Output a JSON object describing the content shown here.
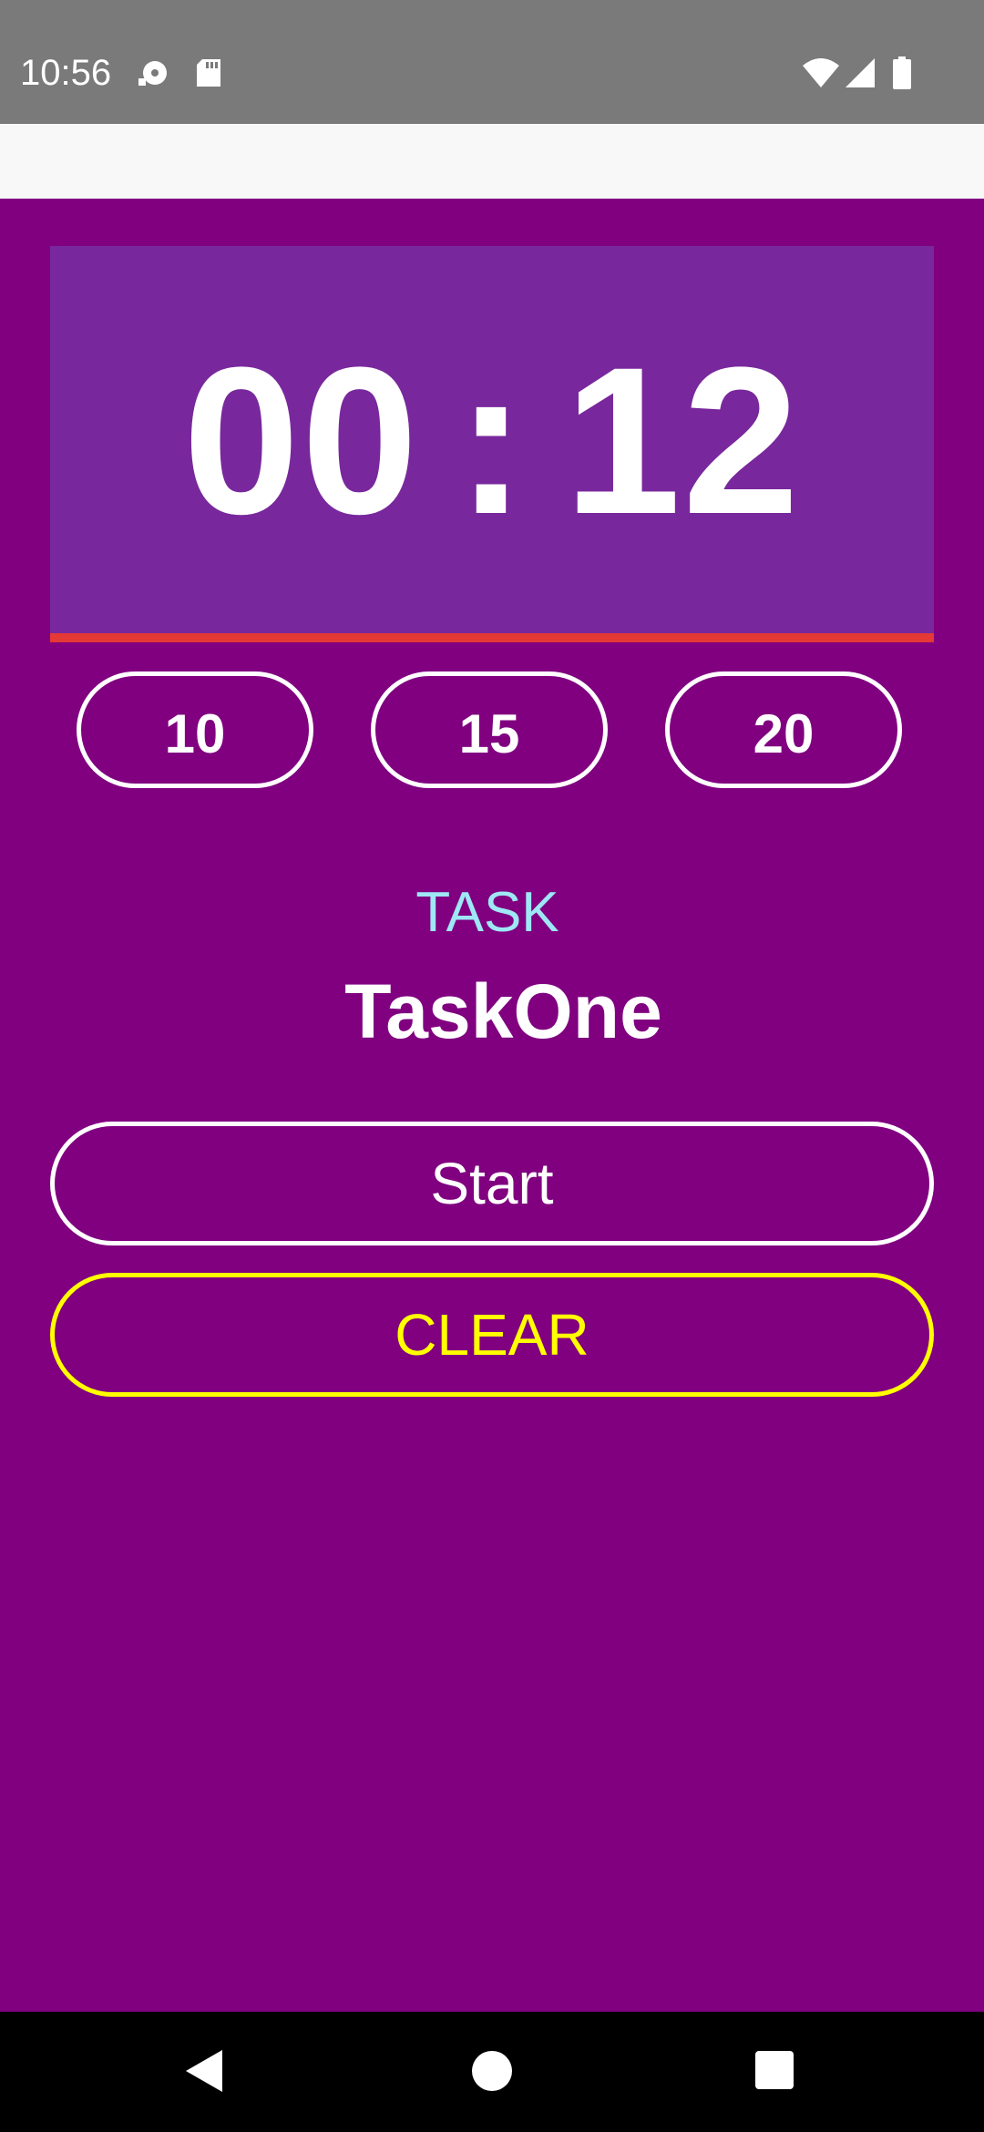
{
  "status_bar": {
    "time": "10:56",
    "icons": [
      "media-icon",
      "sd-card-icon",
      "wifi-icon",
      "signal-icon",
      "battery-icon"
    ]
  },
  "timer": {
    "minutes": "00",
    "separator": ":",
    "seconds": "12"
  },
  "presets": [
    {
      "label": "10"
    },
    {
      "label": "15"
    },
    {
      "label": "20"
    }
  ],
  "task": {
    "label": "TASK",
    "name": "TaskOne"
  },
  "actions": {
    "start_label": "Start",
    "clear_label": "CLEAR"
  },
  "colors": {
    "background": "#800080",
    "timer_panel": "#78289c",
    "timer_underline": "#e53935",
    "task_label": "#9ee7f5",
    "clear_accent": "#ffff00"
  },
  "nav_bar": {
    "icons": [
      "back-icon",
      "home-icon",
      "recents-icon"
    ]
  }
}
